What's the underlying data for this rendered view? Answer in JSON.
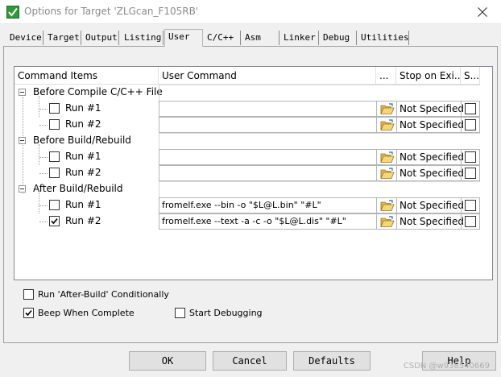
{
  "window": {
    "title": "Options for Target 'ZLGcan_F105RB'",
    "app_icon": "keil-uvision-icon",
    "close_icon": "close-icon"
  },
  "tabs": [
    {
      "label": "Device",
      "active": false
    },
    {
      "label": "Target",
      "active": false
    },
    {
      "label": "Output",
      "active": false
    },
    {
      "label": "Listing",
      "active": false
    },
    {
      "label": "User",
      "active": true
    },
    {
      "label": "C/C++",
      "active": false
    },
    {
      "label": "Asm",
      "active": false
    },
    {
      "label": "Linker",
      "active": false
    },
    {
      "label": "Debug",
      "active": false
    },
    {
      "label": "Utilities",
      "active": false
    }
  ],
  "grid": {
    "headers": {
      "command_items": "Command Items",
      "user_command": "User Command",
      "browse": "...",
      "stop_on_exit": "Stop on Exi...",
      "s": "S..."
    },
    "groups": [
      {
        "label": "Before Compile C/C++ File",
        "runs": [
          {
            "label": "Run #1",
            "checked": false,
            "command": "",
            "stop": "Not Specified",
            "s_checked": false
          },
          {
            "label": "Run #2",
            "checked": false,
            "command": "",
            "stop": "Not Specified",
            "s_checked": false
          }
        ]
      },
      {
        "label": "Before Build/Rebuild",
        "runs": [
          {
            "label": "Run #1",
            "checked": false,
            "command": "",
            "stop": "Not Specified",
            "s_checked": false
          },
          {
            "label": "Run #2",
            "checked": false,
            "command": "",
            "stop": "Not Specified",
            "s_checked": false
          }
        ]
      },
      {
        "label": "After Build/Rebuild",
        "runs": [
          {
            "label": "Run #1",
            "checked": false,
            "command": "fromelf.exe --bin -o \"$L@L.bin\" \"#L\"",
            "stop": "Not Specified",
            "s_checked": false
          },
          {
            "label": "Run #2",
            "checked": true,
            "command": "fromelf.exe --text -a -c -o \"$L@L.dis\" \"#L\"",
            "stop": "Not Specified",
            "s_checked": false
          }
        ]
      }
    ]
  },
  "options": {
    "run_after_build": {
      "label": "Run 'After-Build' Conditionally",
      "checked": false
    },
    "beep": {
      "label": "Beep When Complete",
      "checked": true
    },
    "start_debugging": {
      "label": "Start Debugging",
      "checked": false
    }
  },
  "buttons": {
    "ok": "OK",
    "cancel": "Cancel",
    "defaults": "Defaults",
    "help": "Help"
  },
  "watermark": "CSDN @w938540669"
}
